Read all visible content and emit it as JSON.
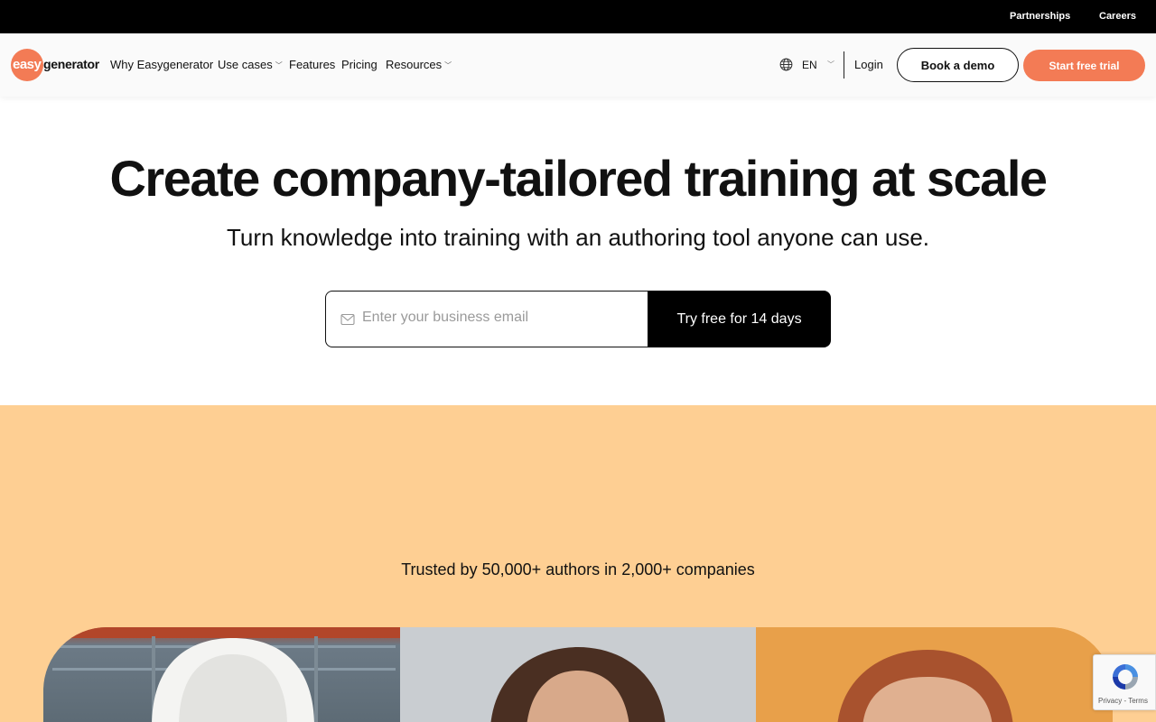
{
  "topbar": {
    "partnerships": "Partnerships",
    "careers": "Careers"
  },
  "logo": {
    "easy": "easy",
    "generator": "generator",
    "color": "#f37b55"
  },
  "nav": {
    "items": [
      {
        "label": "Why Easygenerator",
        "dropdown": false
      },
      {
        "label": "Use cases",
        "dropdown": true
      },
      {
        "label": "Features",
        "dropdown": false
      },
      {
        "label": "Pricing",
        "dropdown": false
      },
      {
        "label": "Resources",
        "dropdown": true
      }
    ],
    "language": "EN",
    "login": "Login",
    "book_demo": "Book a demo",
    "start_trial": "Start free trial",
    "icons": [
      "globe-icon",
      "chevron-down-icon"
    ]
  },
  "hero": {
    "title": "Create company-tailored training at scale",
    "subtitle": "Turn knowledge into training with an authoring tool anyone can use.",
    "email_placeholder": "Enter your business email",
    "email_value": "",
    "cta": "Try free for 14 days"
  },
  "trusted": {
    "text": "Trusted by 50,000+ authors in 2,000+ companies",
    "background": "#fecf93"
  },
  "recaptcha": {
    "footer": "Privacy - Terms"
  },
  "colors": {
    "accent": "#f37b55",
    "dark": "#000000"
  }
}
